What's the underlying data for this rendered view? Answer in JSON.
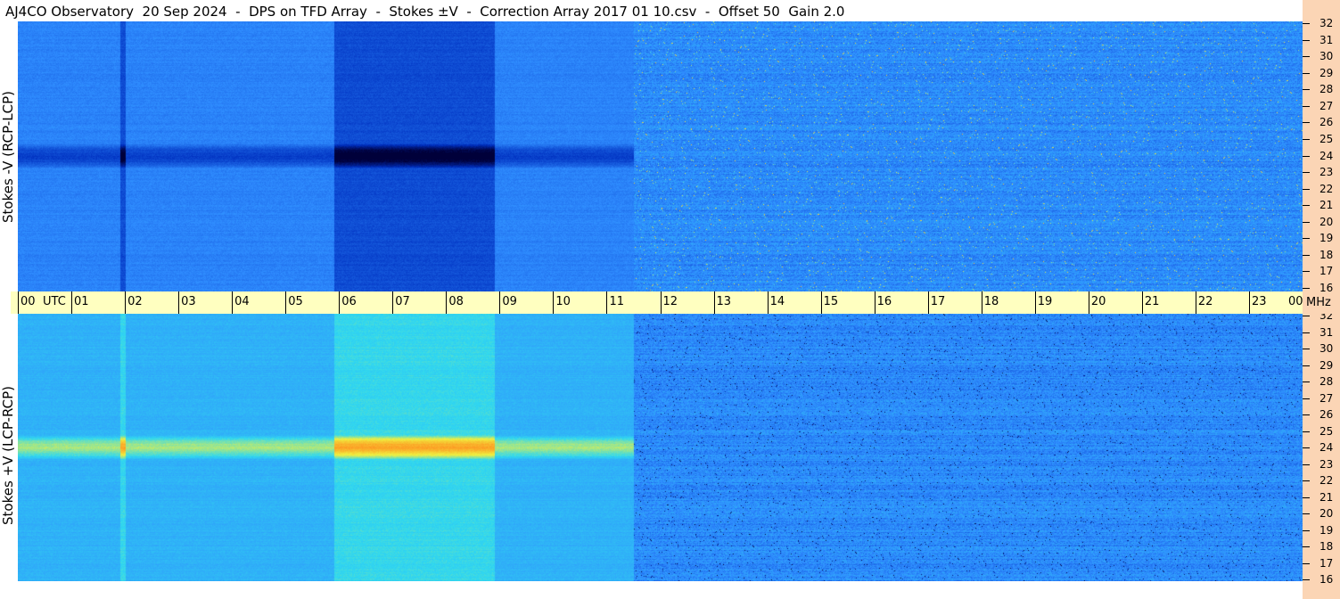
{
  "header": {
    "title": "AJ4CO Observatory  20 Sep 2024  -  DPS on TFD Array  -  Stokes ±V  -  Correction Array 2017 01 10.csv  -  Offset 50  Gain 2.0"
  },
  "chart_data": [
    {
      "type": "heatmap",
      "title": "Stokes -V (RCP-LCP)",
      "xlabel": "UTC",
      "ylabel": "MHz",
      "xlim": [
        0,
        24
      ],
      "ylim": [
        16,
        32
      ],
      "x_ticks": [
        "00",
        "01",
        "02",
        "03",
        "04",
        "05",
        "06",
        "07",
        "08",
        "09",
        "10",
        "11",
        "12",
        "13",
        "14",
        "15",
        "16",
        "17",
        "18",
        "19",
        "20",
        "21",
        "22",
        "23",
        "00"
      ],
      "y_ticks": [
        "16",
        "17",
        "18",
        "19",
        "20",
        "21",
        "22",
        "23",
        "24",
        "25",
        "26",
        "27",
        "28",
        "29",
        "30",
        "31",
        "32"
      ],
      "colormap": [
        "#00003a",
        "#0030c0",
        "#2f8cff",
        "#30d8f0",
        "#f0f040",
        "#ff9020"
      ],
      "features": {
        "dark_bands_utc": [
          [
            1.9,
            2.0
          ],
          [
            5.9,
            6.9
          ],
          [
            6.9,
            8.9
          ]
        ],
        "dark_frequency_band_mhz": [
          23.3,
          24.8
        ],
        "activity_bursts_utc": [
          11.5,
          24
        ]
      }
    },
    {
      "type": "heatmap",
      "title": "Stokes +V (LCP-RCP)",
      "xlabel": "UTC",
      "ylabel": "MHz",
      "xlim": [
        0,
        24
      ],
      "ylim": [
        16,
        32
      ],
      "x_ticks": [
        "00",
        "01",
        "02",
        "03",
        "04",
        "05",
        "06",
        "07",
        "08",
        "09",
        "10",
        "11",
        "12",
        "13",
        "14",
        "15",
        "16",
        "17",
        "18",
        "19",
        "20",
        "21",
        "22",
        "23",
        "00"
      ],
      "y_ticks": [
        "16",
        "17",
        "18",
        "19",
        "20",
        "21",
        "22",
        "23",
        "24",
        "25",
        "26",
        "27",
        "28",
        "29",
        "30",
        "31",
        "32"
      ],
      "colormap": [
        "#00003a",
        "#0030c0",
        "#2f8cff",
        "#30d8f0",
        "#f0f040",
        "#ff9020"
      ],
      "features": {
        "bright_bands_utc": [
          [
            1.9,
            2.0
          ],
          [
            5.9,
            6.9
          ],
          [
            6.9,
            8.9
          ]
        ],
        "bright_frequency_band_mhz": [
          23.3,
          24.8
        ],
        "activity_bursts_utc": [
          11.5,
          24
        ]
      }
    }
  ],
  "axes": {
    "top_label": "Stokes -V (RCP-LCP)",
    "bottom_label": "Stokes +V (LCP-RCP)",
    "utc_unit": "UTC",
    "mhz_unit": "MHz"
  }
}
